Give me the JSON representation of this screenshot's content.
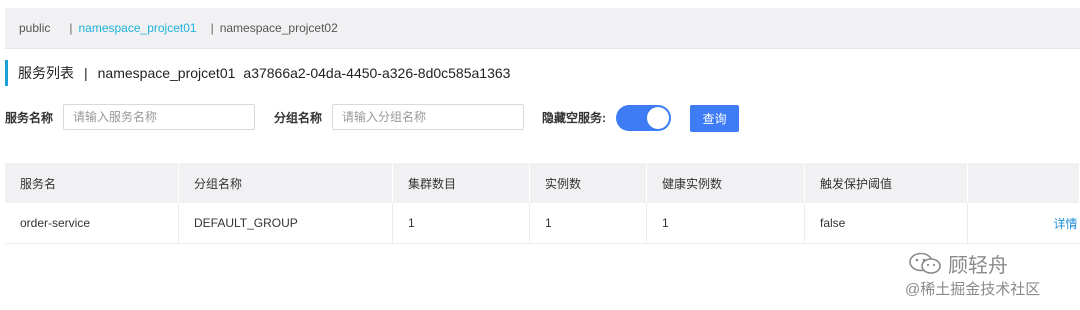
{
  "namespace_tabs": [
    {
      "label": "public"
    },
    {
      "label": "namespace_projcet01",
      "active": true
    },
    {
      "label": "namespace_projcet02"
    }
  ],
  "namespace_separator": "|",
  "title": {
    "section": "服务列表",
    "separator": "|",
    "namespace_name": "namespace_projcet01",
    "namespace_id": "a37866a2-04da-4450-a326-8d0c585a1363"
  },
  "filters": {
    "service_name_label": "服务名称",
    "service_name_placeholder": "请输入服务名称",
    "group_name_label": "分组名称",
    "group_name_placeholder": "请输入分组名称",
    "hide_empty_label": "隐藏空服务:",
    "hide_empty_on": true,
    "query_button": "查询"
  },
  "table": {
    "headers": [
      "服务名",
      "分组名称",
      "集群数目",
      "实例数",
      "健康实例数",
      "触发保护阈值",
      ""
    ],
    "rows": [
      {
        "service": "order-service",
        "group": "DEFAULT_GROUP",
        "clusters": "1",
        "instances": "1",
        "healthy": "1",
        "threshold": "false",
        "action": "详情"
      }
    ]
  },
  "watermark": {
    "author": "顾轻舟",
    "site": "@稀土掘金技术社区"
  },
  "colors": {
    "accent": "#3d7cf5",
    "active_tab": "#1fb1d9",
    "link": "#1f8fd9",
    "title_bar": "#1aa0d6"
  }
}
